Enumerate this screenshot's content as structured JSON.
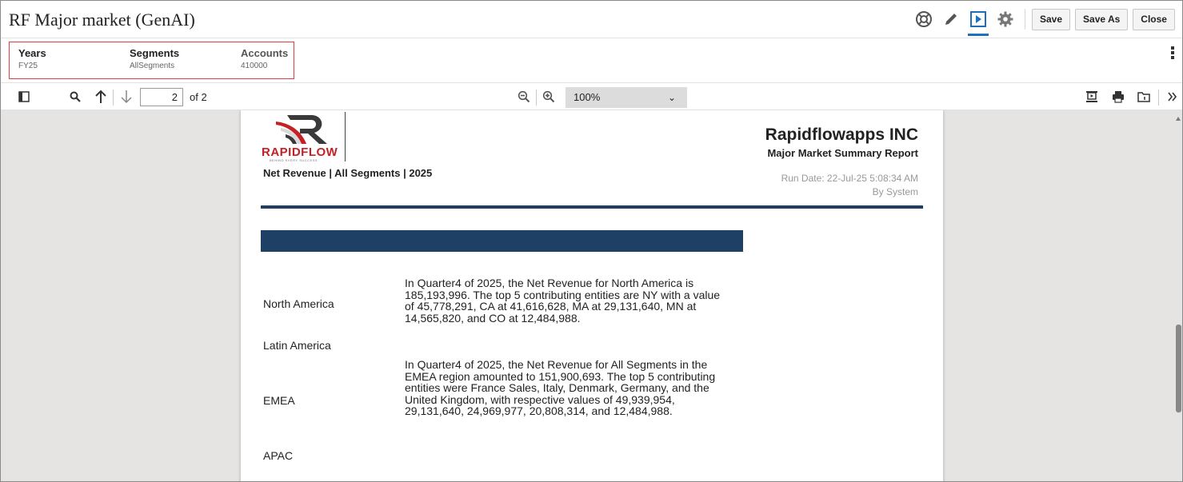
{
  "app": {
    "title": "RF Major market (GenAI)",
    "buttons": {
      "save": "Save",
      "save_as": "Save As",
      "close": "Close"
    },
    "icons": [
      "help-lifebuoy-icon",
      "edit-pencil-icon",
      "run-play-icon",
      "settings-gear-icon"
    ]
  },
  "pov": {
    "items": [
      {
        "label": "Years",
        "value": "FY25"
      },
      {
        "label": "Segments",
        "value": "AllSegments"
      },
      {
        "label": "Accounts",
        "value": "410000"
      }
    ]
  },
  "viewer_toolbar": {
    "page_current": "2",
    "page_total": "of 2",
    "zoom": "100%",
    "zoom_caret": "⌄"
  },
  "report": {
    "logo_text": "RAPIDFLOW",
    "logo_tagline": "BEHIND EVERY SUCCESS",
    "subtitle": "Net Revenue | All Segments | 2025",
    "company": "Rapidflowapps INC",
    "report_title": "Major Market Summary Report",
    "run_date": "Run Date: 22-Jul-25 5:08:34 AM",
    "by": "By System",
    "rows": [
      {
        "region": "North America",
        "text": "In Quarter4 of 2025, the Net Revenue for North America is 185,193,996. The top 5 contributing entities are NY with a value of 45,778,291, CA at 41,616,628, MA at 29,131,640, MN at 14,565,820, and CO at 12,484,988."
      },
      {
        "region": "Latin America",
        "text": ""
      },
      {
        "region": "EMEA",
        "text": "In Quarter4 of 2025, the Net Revenue for All Segments in the EMEA region amounted to 151,900,693. The top 5 contributing entities were France Sales, Italy, Denmark, Germany, and the United Kingdom, with respective values of 49,939,954, 29,131,640, 24,969,977, 20,808,314, and 12,484,988."
      },
      {
        "region": "APAC",
        "text": ""
      }
    ]
  },
  "colors": {
    "accent_blue": "#1f6fbf",
    "report_navy": "#1e4064",
    "pov_highlight": "#e0413f",
    "brand_red": "#c52026"
  }
}
